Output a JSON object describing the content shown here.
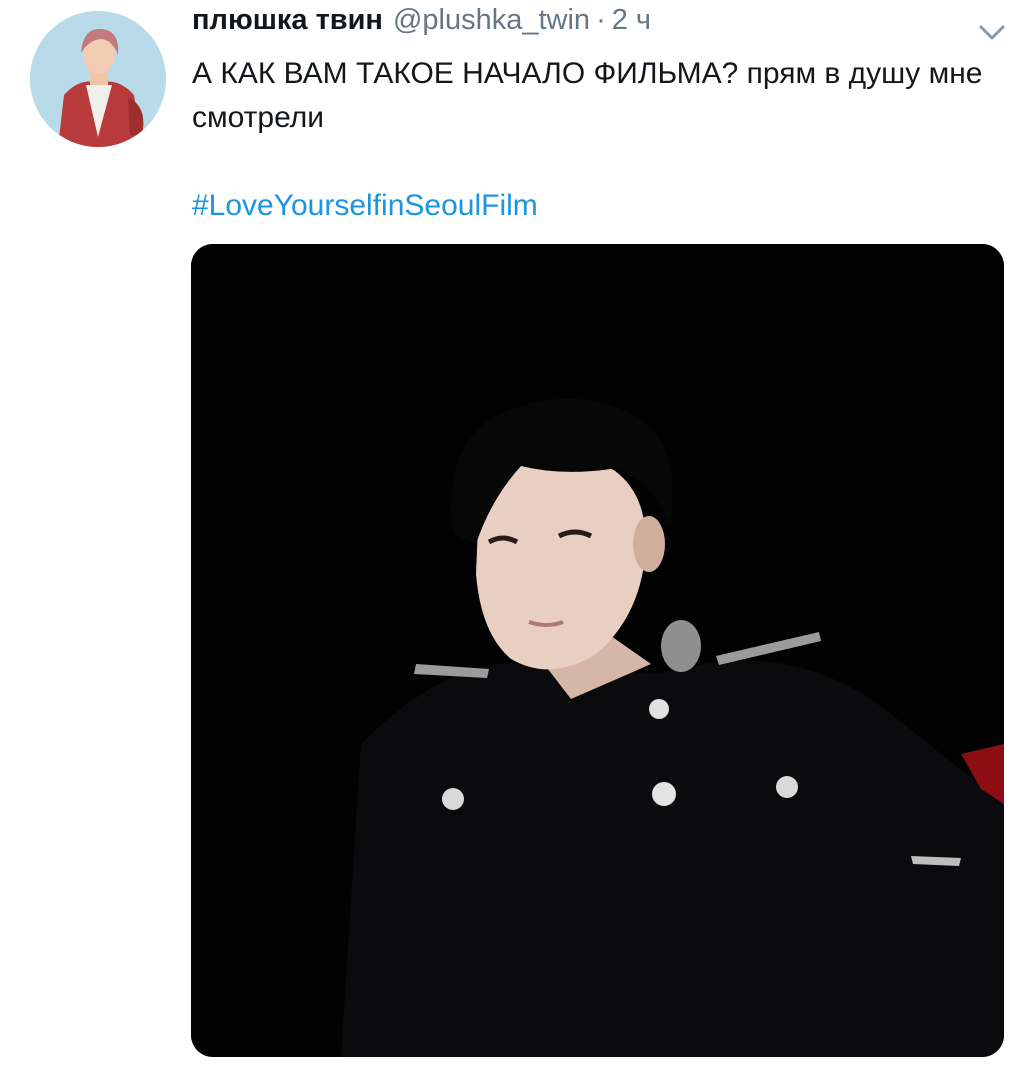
{
  "tweet": {
    "display_name": "плюшка твин",
    "handle": "@plushka_twin",
    "separator": "·",
    "timestamp": "2 ч",
    "text": "А КАК ВАМ ТАКОЕ НАЧАЛО ФИЛЬМА? прям в душу мне смотрели",
    "hashtag": "#LoveYourselfinSeoulFilm"
  },
  "icons": {
    "menu": "chevron-down-icon"
  },
  "colors": {
    "text": "#14171a",
    "secondary": "#657786",
    "link": "#1b95e0",
    "media_background": "#020202"
  }
}
